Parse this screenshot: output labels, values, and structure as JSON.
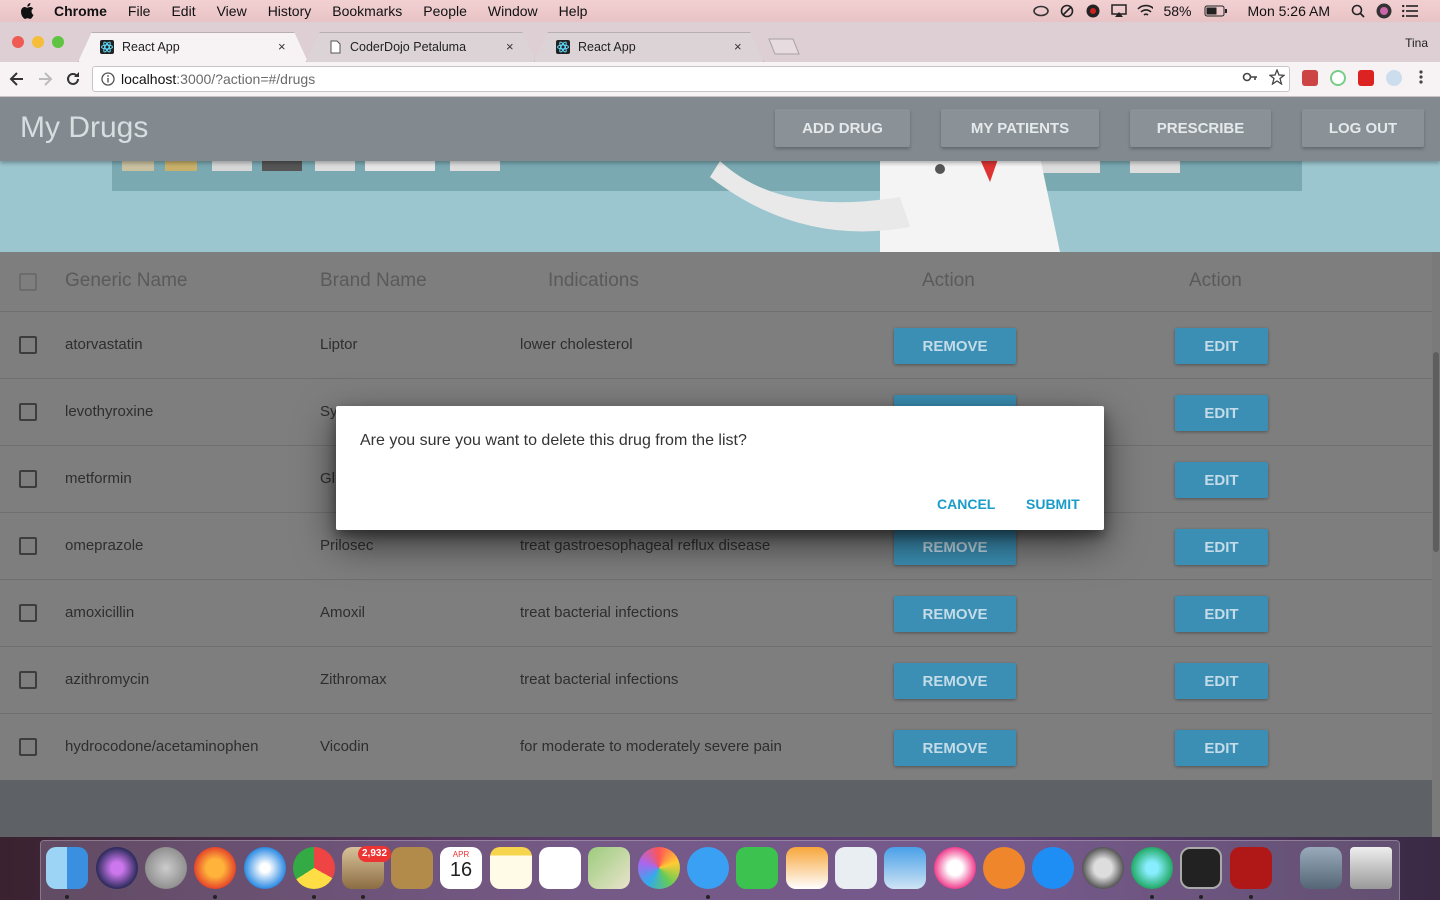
{
  "menubar": {
    "app": "Chrome",
    "items": [
      "File",
      "Edit",
      "View",
      "History",
      "Bookmarks",
      "People",
      "Window",
      "Help"
    ],
    "battery": "58%",
    "clock": "Mon 5:26 AM"
  },
  "tabs": [
    {
      "label": "React App",
      "active": true
    },
    {
      "label": "CoderDojo Petaluma",
      "active": false
    },
    {
      "label": "React App",
      "active": false
    }
  ],
  "profile_name": "Tina",
  "address": {
    "host": "localhost",
    "path": ":3000/?action=#/drugs"
  },
  "app": {
    "title": "My Drugs",
    "nav": [
      "ADD DRUG",
      "MY PATIENTS",
      "PRESCRIBE",
      "LOG OUT"
    ]
  },
  "table": {
    "headers": [
      "Generic Name",
      "Brand Name",
      "Indications",
      "Action",
      "Action"
    ],
    "rows": [
      {
        "generic": "atorvastatin",
        "brand": "Liptor",
        "indication": "lower cholesterol"
      },
      {
        "generic": "levothyroxine",
        "brand": "Sy",
        "indication": ""
      },
      {
        "generic": "metformin",
        "brand": "Gl",
        "indication": ""
      },
      {
        "generic": "omeprazole",
        "brand": "Prilosec",
        "indication": "treat gastroesophageal reflux disease"
      },
      {
        "generic": "amoxicillin",
        "brand": "Amoxil",
        "indication": "treat bacterial infections"
      },
      {
        "generic": "azithromycin",
        "brand": "Zithromax",
        "indication": "treat bacterial infections"
      },
      {
        "generic": "hydrocodone/acetaminophen",
        "brand": "Vicodin",
        "indication": "for moderate to moderately severe pain"
      }
    ],
    "remove_label": "REMOVE",
    "edit_label": "EDIT"
  },
  "dialog": {
    "message": "Are you sure you want to delete this drug from the list?",
    "cancel": "CANCEL",
    "submit": "SUBMIT"
  },
  "dock": {
    "mail_badge": "2,932",
    "calendar_month": "APR",
    "calendar_day": "16"
  },
  "colors": {
    "accent": "#1a9cc8",
    "row_button": "#3b8fb4",
    "appbar": "#828a90"
  }
}
